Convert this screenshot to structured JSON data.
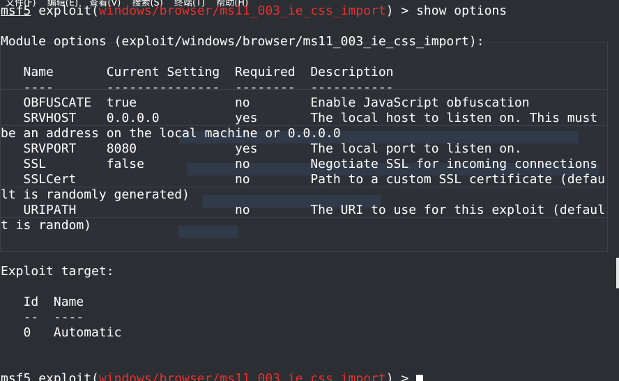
{
  "menu": [
    "文件(F)",
    "编辑(E)",
    "查看(V)",
    "搜索(S)",
    "终端(T)",
    "帮助(H)"
  ],
  "lines": [
    [
      {
        "t": "msf5",
        "c": "prompt"
      },
      {
        "t": " exploit("
      },
      {
        "t": "windows/browser/ms11_003_ie_css_import",
        "c": "red"
      },
      {
        "t": ") > show options"
      }
    ],
    [
      {
        "t": ""
      }
    ],
    [
      {
        "t": "Module options (exploit/windows/browser/ms11_003_ie_css_import):"
      }
    ],
    [
      {
        "t": ""
      }
    ],
    [
      {
        "t": "   Name       Current Setting  Required  Description"
      }
    ],
    [
      {
        "t": "   ----       ---------------  --------  -----------"
      }
    ],
    [
      {
        "t": "   OBFUSCATE  true             no        Enable JavaScript obfuscation"
      }
    ],
    [
      {
        "t": "   SRVHOST    0.0.0.0          yes       The local host to listen on. This must"
      }
    ],
    [
      {
        "t": "be an address on the local machine or 0.0.0.0"
      }
    ],
    [
      {
        "t": "   SRVPORT    8080             yes       The local port to listen on."
      }
    ],
    [
      {
        "t": "   SSL        false            no        Negotiate SSL for incoming connections"
      }
    ],
    [
      {
        "t": "   SSLCert                     no        Path to a custom SSL certificate (defau"
      }
    ],
    [
      {
        "t": "lt is randomly generated)"
      }
    ],
    [
      {
        "t": "   URIPATH                     no        The URI to use for this exploit (defaul"
      }
    ],
    [
      {
        "t": "t is random)"
      }
    ],
    [
      {
        "t": ""
      }
    ],
    [
      {
        "t": ""
      }
    ],
    [
      {
        "t": "Exploit target:"
      }
    ],
    [
      {
        "t": ""
      }
    ],
    [
      {
        "t": "   Id  Name"
      }
    ],
    [
      {
        "t": "   --  ----"
      }
    ],
    [
      {
        "t": "   0   Automatic"
      }
    ],
    [
      {
        "t": ""
      }
    ],
    [
      {
        "t": ""
      }
    ],
    [
      {
        "t": "msf5",
        "c": "prompt"
      },
      {
        "t": " exploit("
      },
      {
        "t": "windows/browser/ms11_003_ie_css_import",
        "c": "red"
      },
      {
        "t": ") > "
      }
    ]
  ],
  "colors": {
    "background": "#2b2e33",
    "text": "#ffffff",
    "module_path": "#e8302e"
  }
}
